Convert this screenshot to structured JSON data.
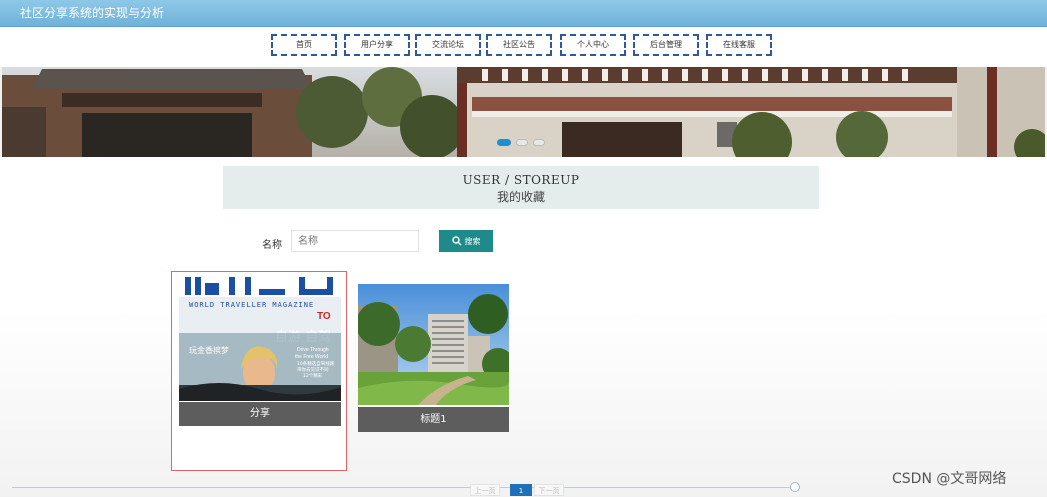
{
  "header": {
    "title": "社区分享系统的实现与分析"
  },
  "nav": {
    "items": [
      {
        "label": "首页"
      },
      {
        "label": "用户分享"
      },
      {
        "label": "交流论坛"
      },
      {
        "label": "社区公告"
      },
      {
        "label": "个人中心"
      },
      {
        "label": "后台管理"
      },
      {
        "label": "在线客服"
      }
    ]
  },
  "carousel": {
    "slide_count": 3,
    "active_index": 0
  },
  "breadcrumb": {
    "en": "USER / STOREUP",
    "cn": "我的收藏"
  },
  "search": {
    "label": "名称",
    "placeholder": "名称",
    "button_label": "搜索"
  },
  "cards": [
    {
      "caption": "分享",
      "image_texts": {
        "masthead": "WORLD TRAVELLER MAGAZINE",
        "brand": "TO",
        "headline": "自游 自驾",
        "side": "玩金香槟梦",
        "sub1": "Drive Through",
        "sub2": "the Free World",
        "sub3": "10条精选自驾线路",
        "sub4": "带你去见识不同",
        "sub5": "12个精彩"
      }
    },
    {
      "caption": "标题1"
    }
  ],
  "pagination": {
    "prev": "上一页",
    "current": "1",
    "next": "下一页"
  },
  "watermark": "CSDN @文哥网络",
  "colors": {
    "accent": "#1f8a8a",
    "header": "#7dbde2",
    "nav_border": "#2d5a9c"
  }
}
